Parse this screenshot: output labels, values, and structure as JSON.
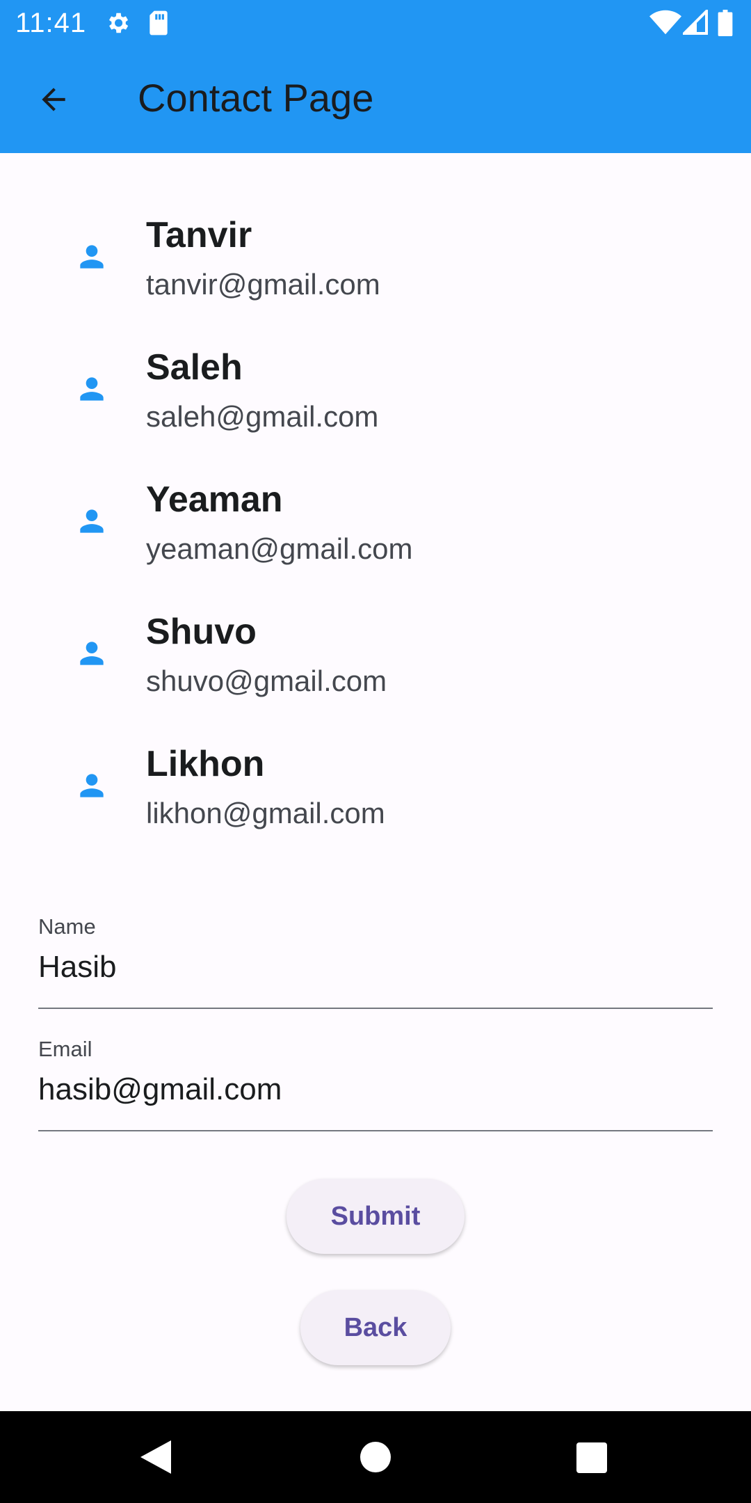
{
  "status_bar": {
    "time": "11:41",
    "icons": [
      "gear-icon",
      "sd-card-icon",
      "wifi-icon",
      "cell-signal-icon",
      "battery-icon"
    ]
  },
  "app_bar": {
    "title": "Contact Page",
    "back_icon": "arrow-back-icon",
    "background_color": "#2196f3"
  },
  "contacts": [
    {
      "name": "Tanvir",
      "email": "tanvir@gmail.com",
      "icon": "person-icon"
    },
    {
      "name": "Saleh",
      "email": "saleh@gmail.com",
      "icon": "person-icon"
    },
    {
      "name": "Yeaman",
      "email": "yeaman@gmail.com",
      "icon": "person-icon"
    },
    {
      "name": "Shuvo",
      "email": "shuvo@gmail.com",
      "icon": "person-icon"
    },
    {
      "name": "Likhon",
      "email": "likhon@gmail.com",
      "icon": "person-icon"
    }
  ],
  "form": {
    "name_label": "Name",
    "name_value": "Hasib",
    "email_label": "Email",
    "email_value": "hasib@gmail.com"
  },
  "buttons": {
    "submit_label": "Submit",
    "back_label": "Back"
  },
  "colors": {
    "accent": "#2196f3",
    "button_text": "#5a4da0",
    "button_bg": "#f4eff7"
  },
  "nav_bar": {
    "icons": [
      "nav-back-icon",
      "nav-home-icon",
      "nav-recents-icon"
    ]
  }
}
